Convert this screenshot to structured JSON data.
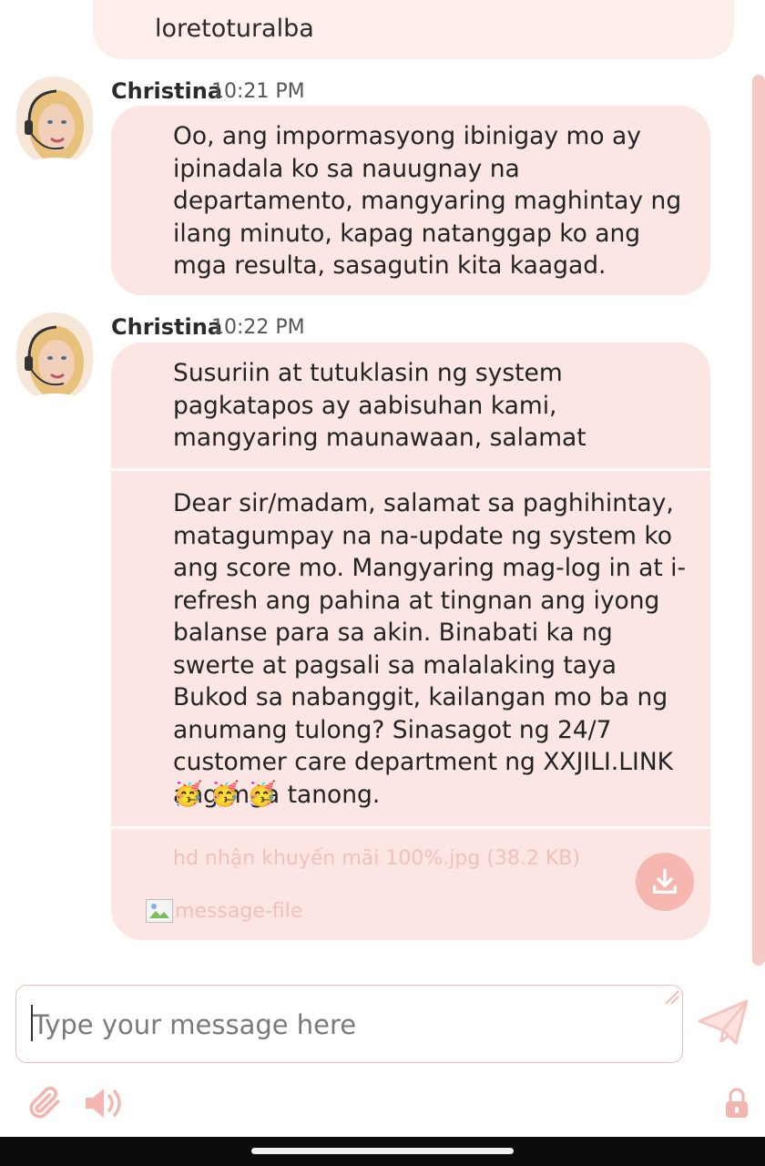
{
  "previous_message": {
    "text": "loretoturalba"
  },
  "messages": [
    {
      "sender": "Christina",
      "time": "10:21 PM",
      "text": "Oo, ang impormasyong ibinigay mo ay ipinadala ko sa nauugnay na departamento, mangyaring maghintay ng ilang minuto, kapag natanggap ko ang mga resulta, sasagutin kita kaagad."
    },
    {
      "sender": "Christina",
      "time": "10:22 PM",
      "text": "Susuriin at tutuklasin ng system pagkatapos ay aabisuhan kami, mangyaring maunawaan, salamat",
      "text2": "Dear sir/madam, salamat sa paghihintay, matagumpay na na-update ng system ko ang score mo. Mangyaring mag-log in at i-refresh ang pahina at tingnan ang iyong balanse para sa akin. Binabati ka ng swerte at pagsali sa malalaking taya Bukod sa nabanggit, kailangan mo ba ng anumang tulong? Sinasagot ng 24/7 customer care department ng XXJILI.LINK ang mga tanong.",
      "emojis": "🥳 🥳 🥳",
      "file_name": "hd nhận khuyến mãi 100%.jpg (38.2 KB)",
      "file_alt": "message-file"
    }
  ],
  "composer": {
    "placeholder": "Type your message here"
  },
  "icons": {
    "download": "download-icon",
    "send": "send-icon",
    "attach": "paperclip-icon",
    "sound": "speaker-icon",
    "lock": "lock-icon"
  },
  "colors": {
    "accent": "#f7b7b1",
    "bubble": "#fbe6e4"
  }
}
